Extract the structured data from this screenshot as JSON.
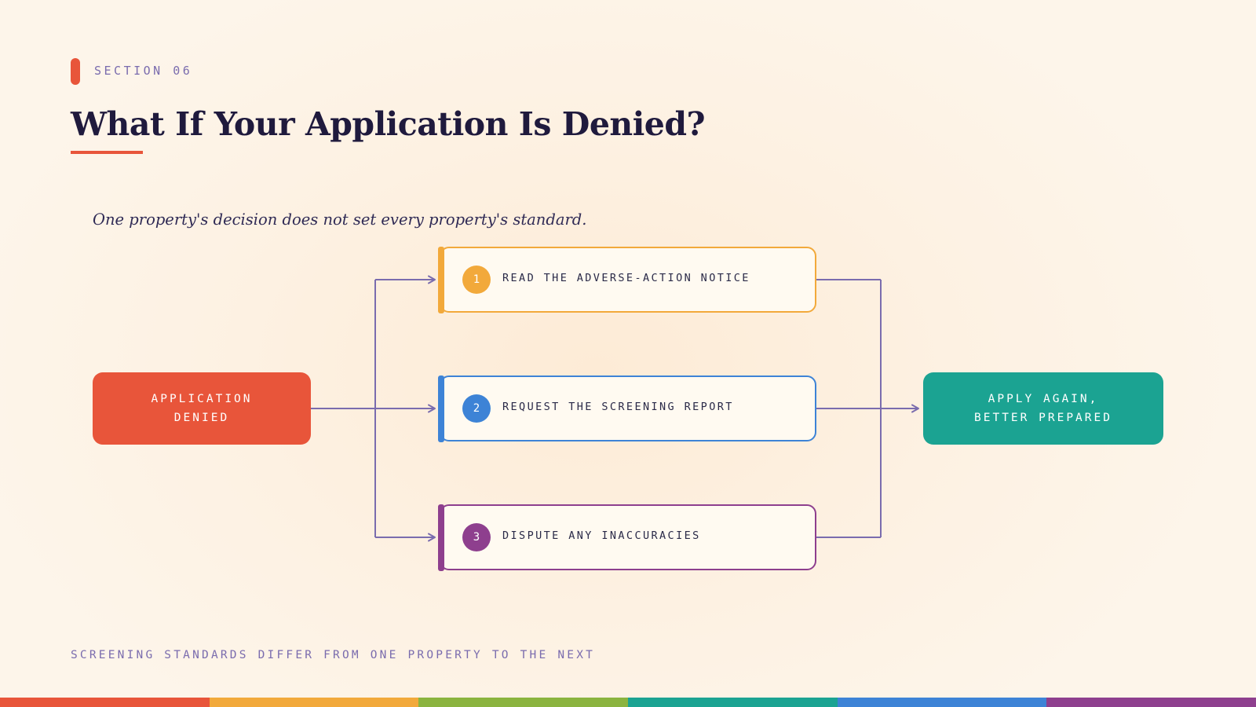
{
  "section": {
    "label": "SECTION 06"
  },
  "header": {
    "title": "What If Your Application Is Denied?"
  },
  "subtitle": "One property's decision does not set every property's standard.",
  "diagram": {
    "start": {
      "label": "APPLICATION\nDENIED",
      "color": "#e8553a"
    },
    "steps": [
      {
        "number": "1",
        "label": "READ THE ADVERSE-ACTION NOTICE",
        "color": "#f2a93b"
      },
      {
        "number": "2",
        "label": "REQUEST THE SCREENING REPORT",
        "color": "#3d83d6"
      },
      {
        "number": "3",
        "label": "DISPUTE ANY INACCURACIES",
        "color": "#8e3f8e"
      }
    ],
    "end": {
      "label": "APPLY AGAIN,\nBETTER PREPARED",
      "color": "#1ba392"
    },
    "connector_color": "#7a6cae"
  },
  "footer": {
    "note": "SCREENING STANDARDS DIFFER FROM ONE PROPERTY TO THE NEXT"
  },
  "stripe_colors": [
    "#e8553a",
    "#f2a93b",
    "#8bb43f",
    "#1ba392",
    "#3d83d6",
    "#8e3f8e"
  ]
}
